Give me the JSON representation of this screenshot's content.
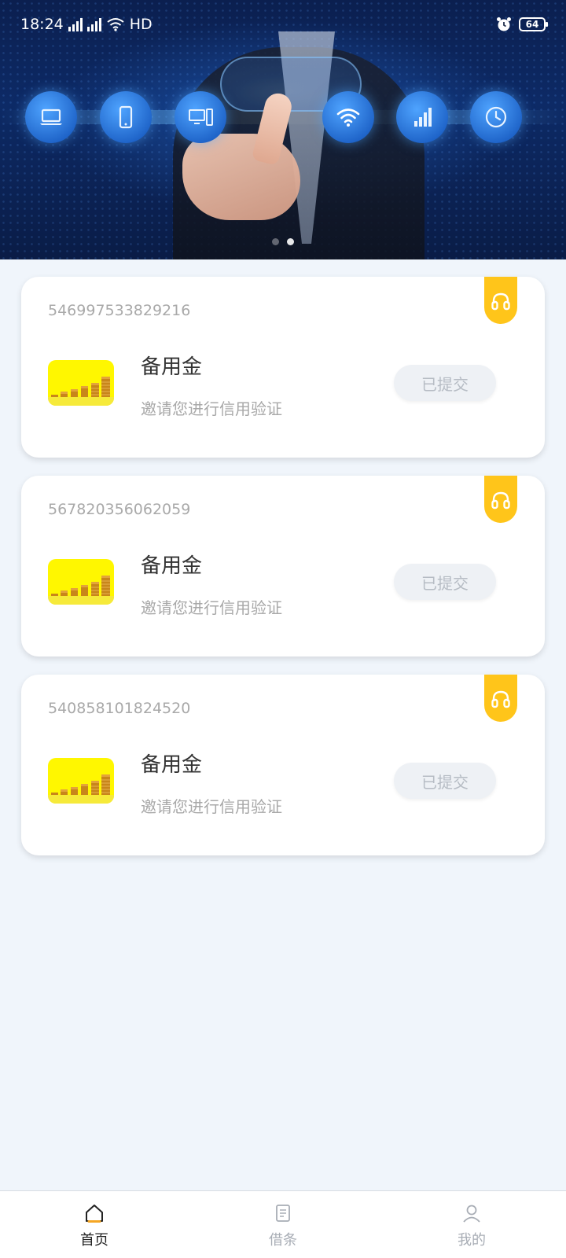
{
  "status_bar": {
    "time": "18:24",
    "network_1": "4G",
    "network_2": "4G",
    "hd": "HD",
    "battery": "64"
  },
  "banner": {
    "icons": [
      "laptop-icon",
      "phone-icon",
      "desktop-icon",
      "wifi-icon",
      "signal-bars-icon",
      "clock-icon"
    ],
    "page_count": 2,
    "active_page": 1
  },
  "orders": [
    {
      "order_no": "546997533829216",
      "product_name": "备用金",
      "description": "邀请您进行信用验证",
      "status": "已提交"
    },
    {
      "order_no": "567820356062059",
      "product_name": "备用金",
      "description": "邀请您进行信用验证",
      "status": "已提交"
    },
    {
      "order_no": "540858101824520",
      "product_name": "备用金",
      "description": "邀请您进行信用验证",
      "status": "已提交"
    }
  ],
  "bottom_nav": {
    "items": [
      {
        "label": "首页",
        "icon": "home-icon",
        "active": true
      },
      {
        "label": "借条",
        "icon": "document-icon",
        "active": false
      },
      {
        "label": "我的",
        "icon": "user-icon",
        "active": false
      }
    ]
  },
  "colors": {
    "background": "#f0f5fb",
    "accent_support": "#ffc51a",
    "thumb_bg": "#fff700",
    "status_button_bg": "#eef1f5",
    "status_button_text": "#b6bcc4",
    "nav_active_accent": "#f5a623"
  }
}
